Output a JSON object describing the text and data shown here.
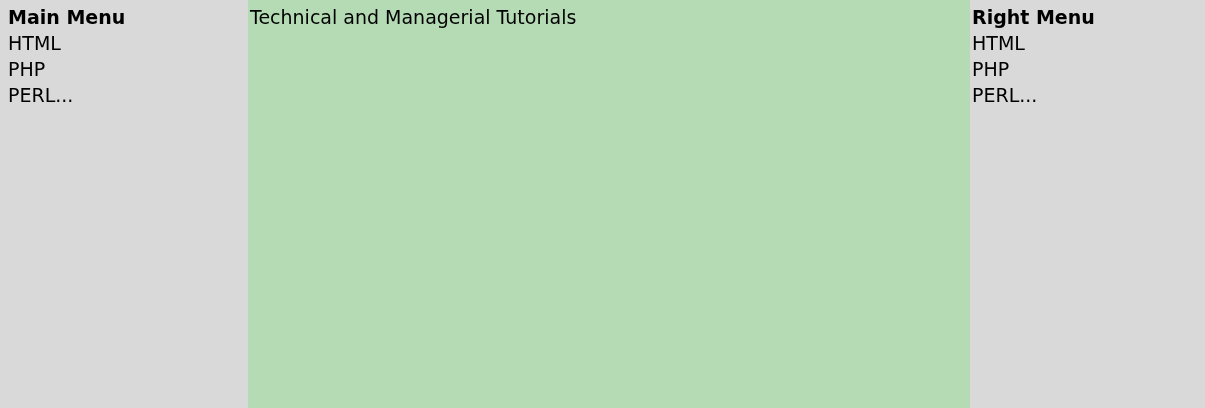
{
  "left_menu": {
    "title": "Main Menu",
    "items": [
      "HTML",
      "PHP",
      "PERL..."
    ]
  },
  "content": {
    "heading": "Technical and Managerial Tutorials"
  },
  "right_menu": {
    "title": "Right Menu",
    "items": [
      "HTML",
      "PHP",
      "PERL..."
    ]
  }
}
